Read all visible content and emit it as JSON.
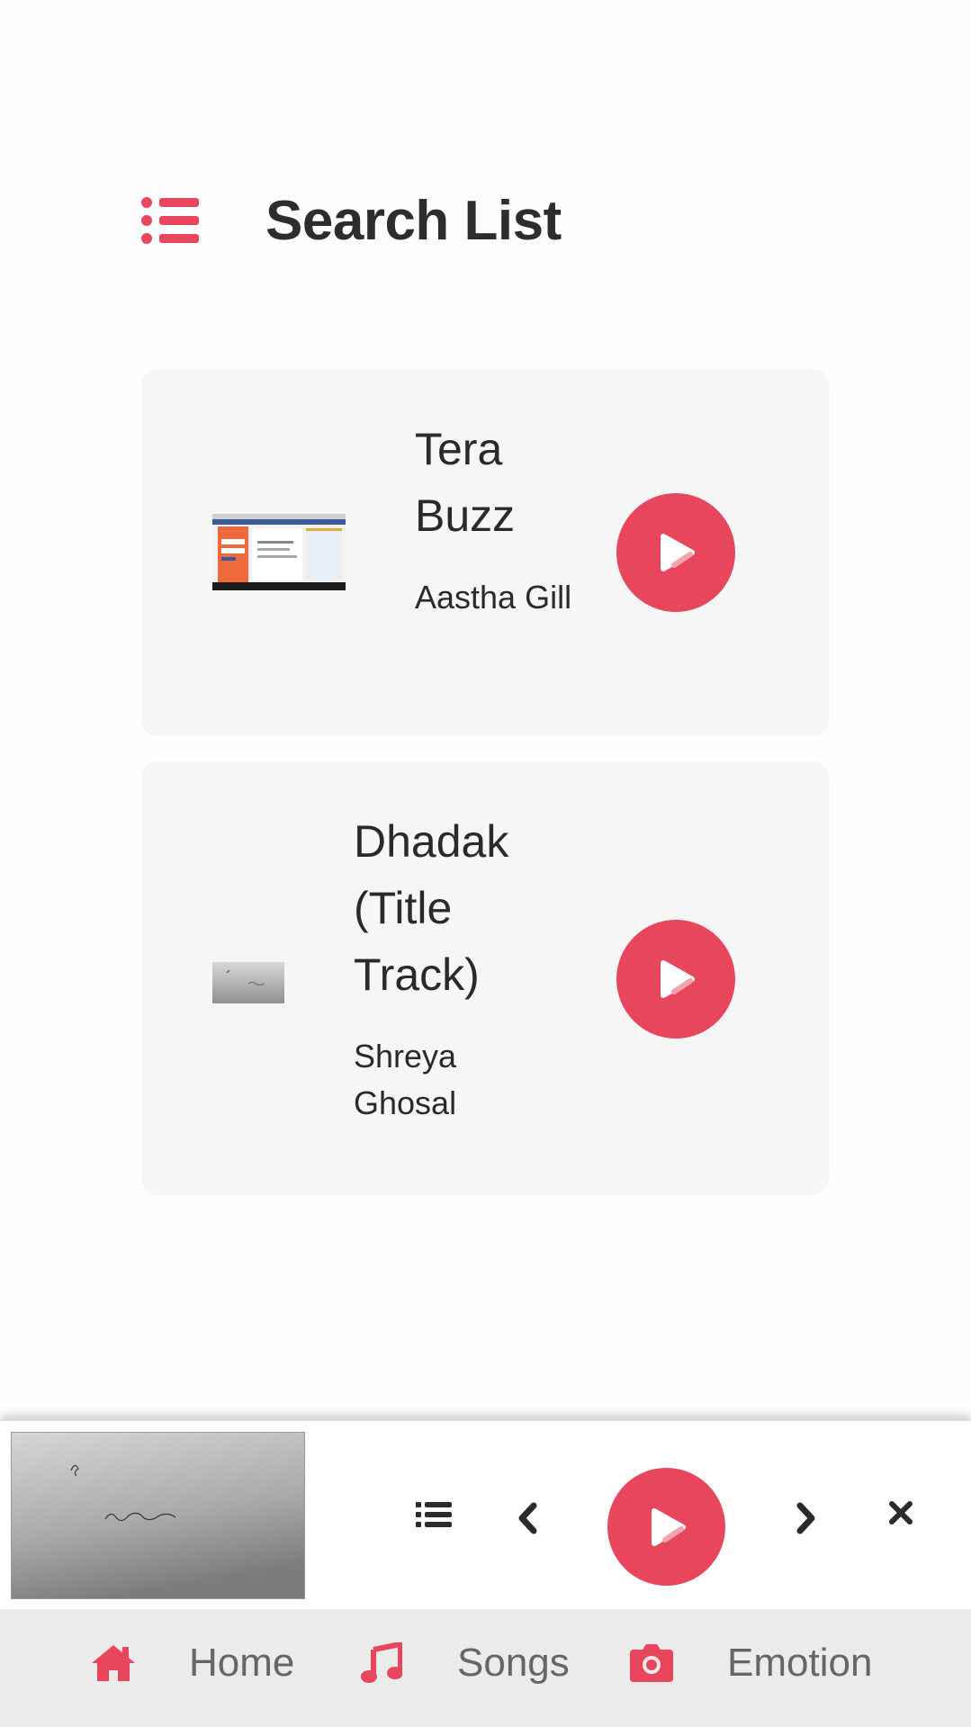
{
  "header": {
    "title": "Search List",
    "menu_icon": "list-icon"
  },
  "songs": [
    {
      "title": "Tera Buzz",
      "artist": "Aastha Gill",
      "play_icon": "play-icon"
    },
    {
      "title": "Dhadak (Title Track)",
      "artist": "Shreya Ghosal",
      "play_icon": "play-icon"
    }
  ],
  "player": {
    "controls": [
      "list-icon",
      "chevron-left-icon",
      "play-icon",
      "chevron-right-icon",
      "close-icon"
    ]
  },
  "nav": {
    "items": [
      {
        "label": "Home",
        "icon": "home-icon"
      },
      {
        "label": "Songs",
        "icon": "music-note-icon"
      },
      {
        "label": "Emotion",
        "icon": "camera-icon"
      }
    ]
  },
  "colors": {
    "accent": "#e8465d",
    "card_bg": "#f6f6f7",
    "nav_bg": "#ebebec",
    "text": "#2b2b2b",
    "nav_text": "#666666"
  }
}
